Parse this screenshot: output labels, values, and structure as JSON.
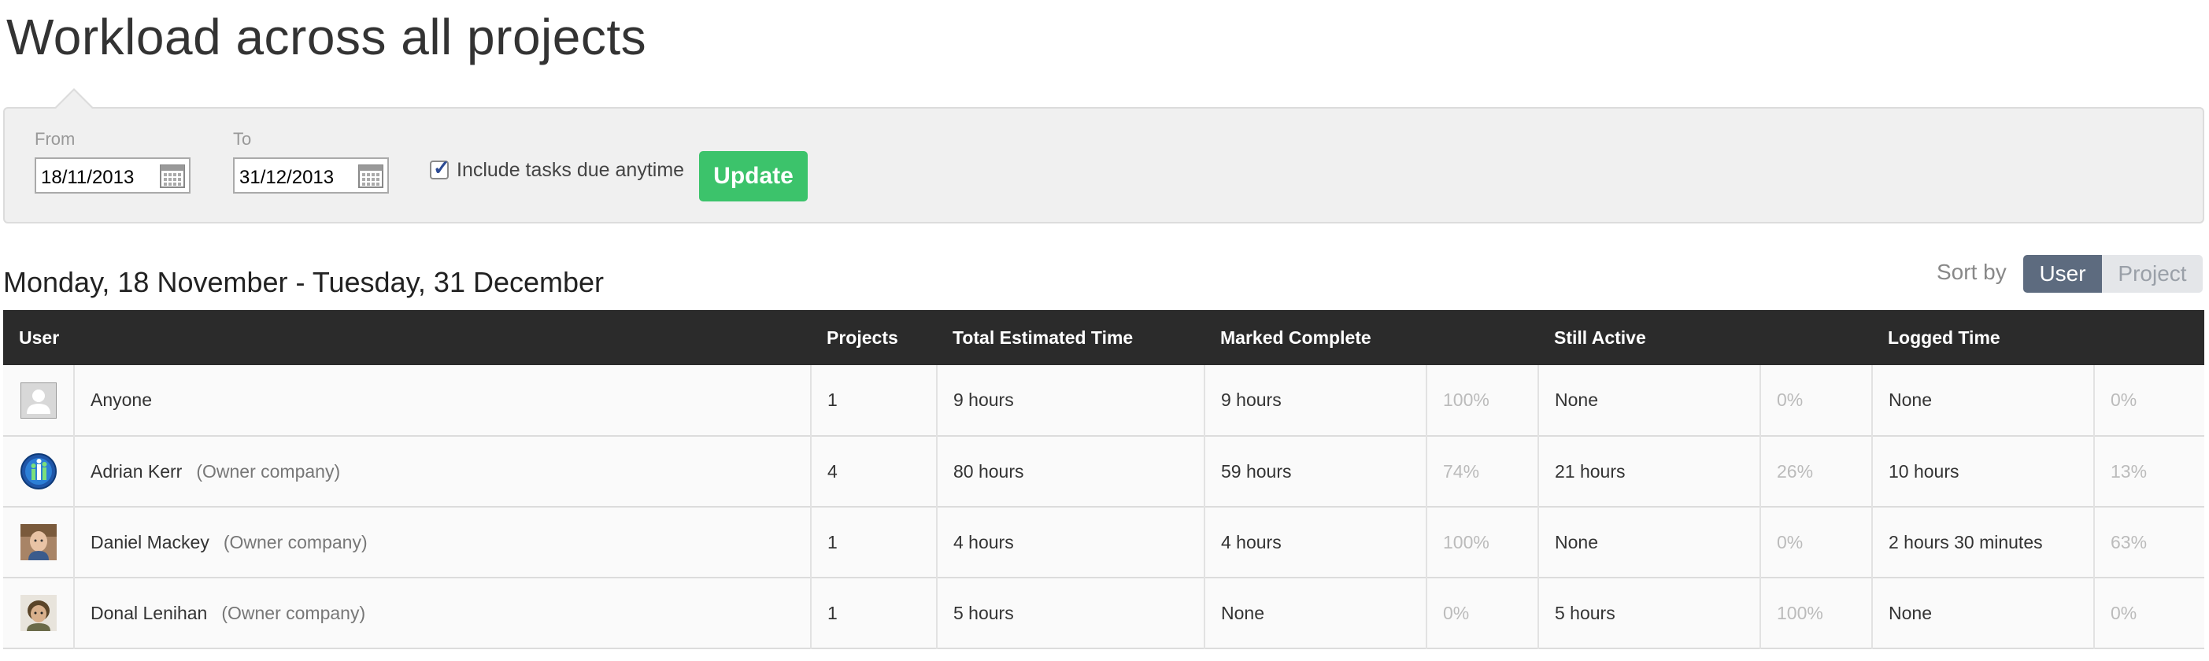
{
  "page": {
    "title": "Workload across all projects"
  },
  "filters": {
    "from_label": "From",
    "from_value": "18/11/2013",
    "to_label": "To",
    "to_value": "31/12/2013",
    "include_label": "Include tasks due anytime",
    "include_checked": true,
    "update_label": "Update"
  },
  "range_heading": "Monday, 18 November - Tuesday, 31 December",
  "sort": {
    "label": "Sort by",
    "options": [
      "User",
      "Project"
    ],
    "selected": "User"
  },
  "table": {
    "headers": {
      "user": "User",
      "projects": "Projects",
      "total": "Total Estimated Time",
      "complete": "Marked Complete",
      "active": "Still Active",
      "logged": "Logged Time"
    },
    "rows": [
      {
        "avatar": "generic-user-icon",
        "name": "Anyone",
        "company": "",
        "projects": "1",
        "total": "9 hours",
        "complete": "9 hours",
        "complete_pct": "100%",
        "active": "None",
        "active_pct": "0%",
        "logged": "None",
        "logged_pct": "0%"
      },
      {
        "avatar": "team-logo-icon",
        "name": "Adrian Kerr",
        "company": "(Owner company)",
        "projects": "4",
        "total": "80 hours",
        "complete": "59 hours",
        "complete_pct": "74%",
        "active": "21 hours",
        "active_pct": "26%",
        "logged": "10 hours",
        "logged_pct": "13%"
      },
      {
        "avatar": "photo-avatar",
        "name": "Daniel Mackey",
        "company": "(Owner company)",
        "projects": "1",
        "total": "4 hours",
        "complete": "4 hours",
        "complete_pct": "100%",
        "active": "None",
        "active_pct": "0%",
        "logged": "2 hours 30 minutes",
        "logged_pct": "63%"
      },
      {
        "avatar": "photo-avatar",
        "name": "Donal Lenihan",
        "company": "(Owner company)",
        "projects": "1",
        "total": "5 hours",
        "complete": "None",
        "complete_pct": "0%",
        "active": "5 hours",
        "active_pct": "100%",
        "logged": "None",
        "logged_pct": "0%"
      }
    ]
  },
  "colors": {
    "accent_green": "#3cc36b",
    "header_dark": "#2b2b2b",
    "sort_active": "#5d6b7f"
  }
}
